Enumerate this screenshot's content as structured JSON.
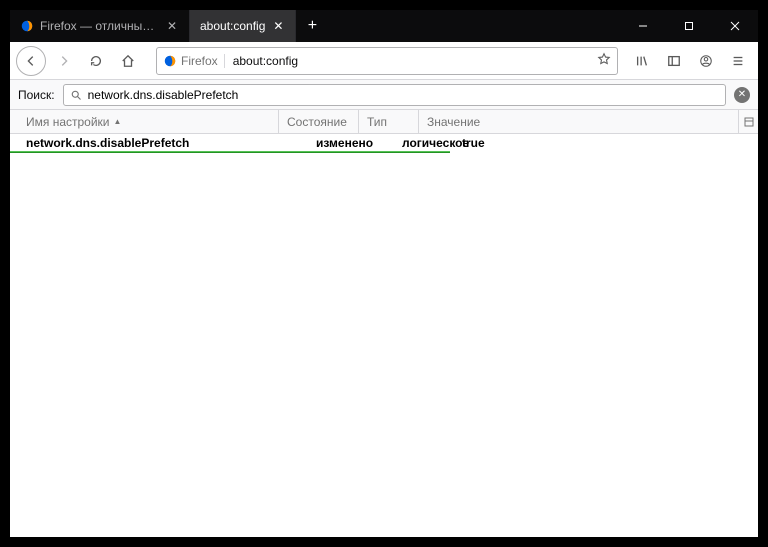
{
  "tabs": [
    {
      "label": "Firefox — отличный браузер",
      "active": false
    },
    {
      "label": "about:config",
      "active": true
    }
  ],
  "urlbar": {
    "identity_label": "Firefox",
    "url": "about:config"
  },
  "filter": {
    "label": "Поиск:",
    "value": "network.dns.disablePrefetch"
  },
  "columns": {
    "name": "Имя настройки",
    "status": "Состояние",
    "type": "Тип",
    "value": "Значение"
  },
  "row": {
    "name": "network.dns.disablePrefetch",
    "status": "изменено",
    "type": "логическое",
    "value": "true"
  }
}
